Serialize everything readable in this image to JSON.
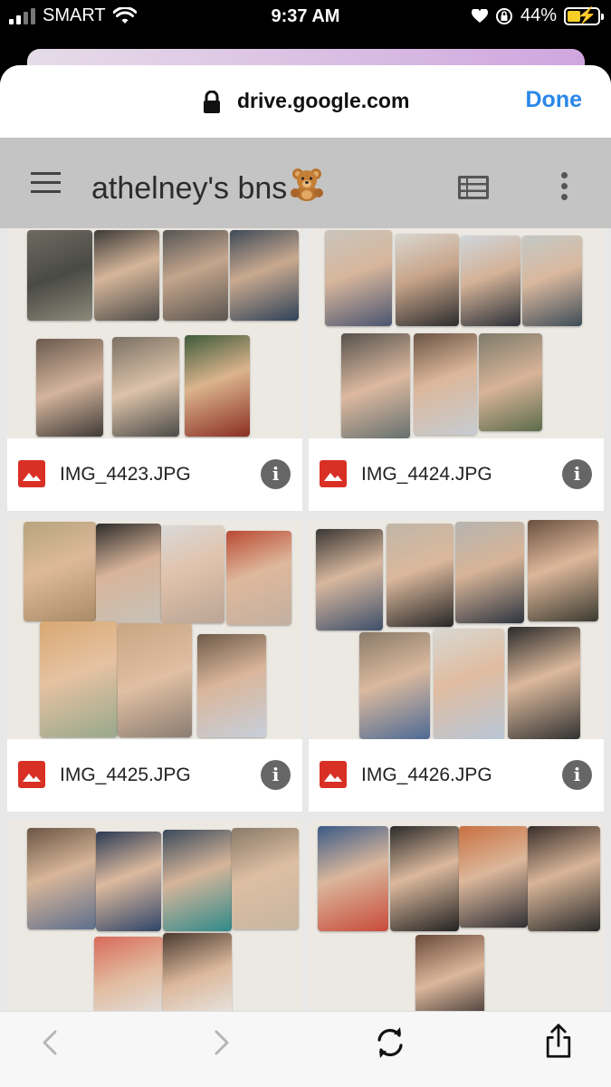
{
  "status_bar": {
    "carrier": "SMART",
    "time": "9:37 AM",
    "battery_percent": "44%"
  },
  "browser": {
    "url": "drive.google.com",
    "done_label": "Done"
  },
  "drive": {
    "folder_title": "athelney's bns"
  },
  "files": [
    {
      "name": "IMG_4423.JPG"
    },
    {
      "name": "IMG_4424.JPG"
    },
    {
      "name": "IMG_4425.JPG"
    },
    {
      "name": "IMG_4426.JPG"
    },
    {
      "name": "",
      "partial": true
    },
    {
      "name": "",
      "partial": true
    }
  ],
  "colors": {
    "accent": "#2a87e8",
    "image_icon": "#d93025",
    "appbar": "#c4c4c4",
    "battery": "#f5cf25"
  },
  "icons": {
    "menu": "hamburger-icon",
    "view": "list-view-icon",
    "more": "more-vert-icon",
    "file": "image-file-icon",
    "info": "info-icon",
    "back": "chevron-left-icon",
    "forward": "chevron-right-icon",
    "reload": "reload-icon",
    "share": "share-icon"
  }
}
